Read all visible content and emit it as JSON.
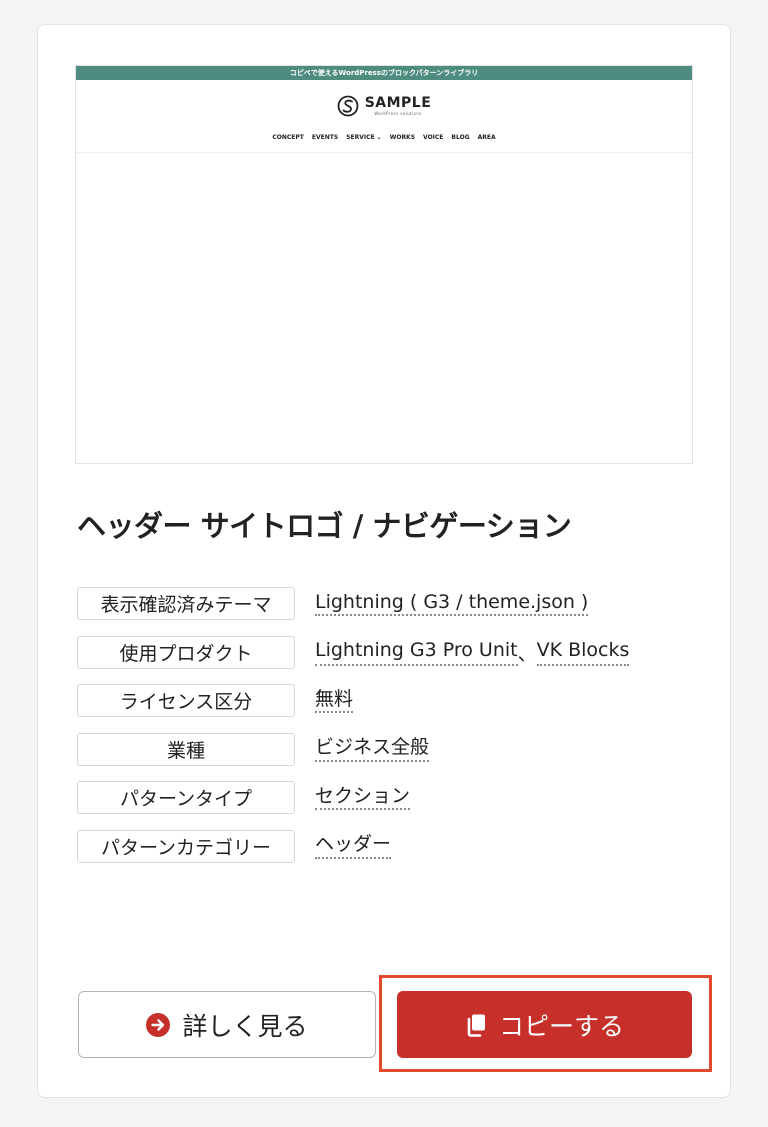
{
  "preview": {
    "topbar_text": "コピペで使えるWordPressのブロックパターンライブラリ",
    "logo_name": "SAMPLE",
    "logo_tagline": "WordPress solutions",
    "nav": [
      "CONCEPT",
      "EVENTS",
      "SERVICE ⌄",
      "WORKS",
      "VOICE",
      "BLOG",
      "AREA"
    ],
    "topbar_color": "#4f8c80"
  },
  "pattern": {
    "title": "ヘッダー サイトロゴ / ナビゲーション"
  },
  "meta": [
    {
      "label": "表示確認済みテーマ",
      "values": [
        "Lightning ( G3 / theme.json )"
      ]
    },
    {
      "label": "使用プロダクト",
      "values": [
        "Lightning G3 Pro Unit",
        "、",
        "VK Blocks"
      ]
    },
    {
      "label": "ライセンス区分",
      "values": [
        "無料"
      ]
    },
    {
      "label": "業種",
      "values": [
        "ビジネス全般"
      ]
    },
    {
      "label": "パターンタイプ",
      "values": [
        "セクション"
      ]
    },
    {
      "label": "パターンカテゴリー",
      "values": [
        "ヘッダー"
      ]
    }
  ],
  "buttons": {
    "detail_label": "詳しく見る",
    "copy_label": "コピーする",
    "accent_color": "#c7302a",
    "highlight_color": "#e2492e"
  }
}
